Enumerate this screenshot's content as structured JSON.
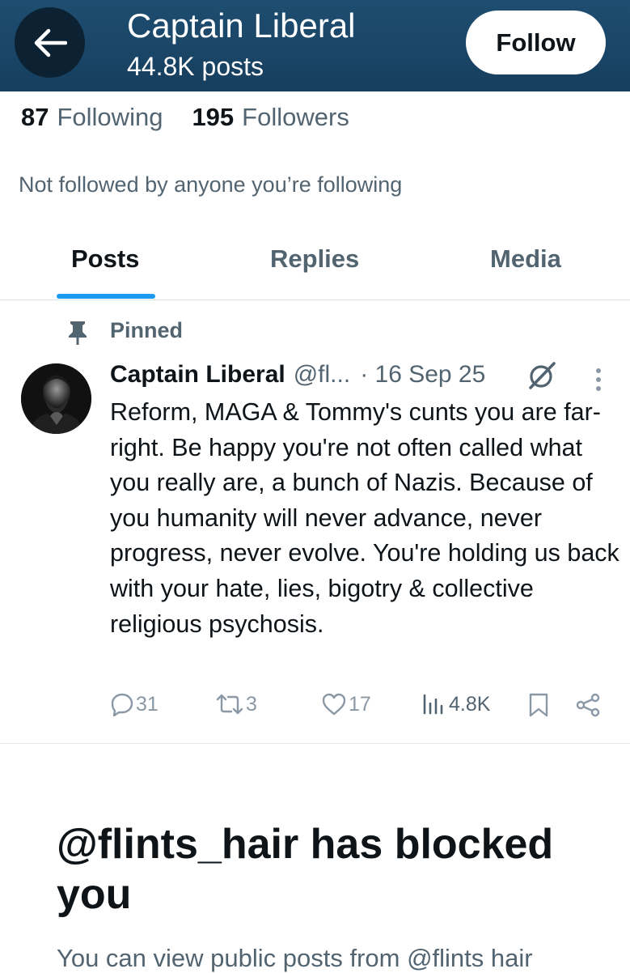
{
  "header": {
    "title": "Captain Liberal",
    "post_count": "44.8K posts",
    "follow_label": "Follow"
  },
  "stats": {
    "following_count": "87",
    "following_label": "Following",
    "followers_count": "195",
    "followers_label": "Followers"
  },
  "not_followed_text": "Not followed by anyone you’re following",
  "tabs": [
    {
      "label": "Posts",
      "active": true
    },
    {
      "label": "Replies",
      "active": false
    },
    {
      "label": "Media",
      "active": false
    }
  ],
  "pinned_tweet": {
    "pinned_label": "Pinned",
    "name": "Captain Liberal",
    "handle": "@fl...",
    "date": "· 16 Sep 25",
    "text": "Reform, MAGA & Tommy's cunts you are far-right. Be happy you're not often called what you really are, a bunch of Nazis. Because of you humanity will never advance, never progress, never evolve. You're holding us back with your hate, lies, bigotry & collective religious psychosis.",
    "replies": "31",
    "reposts": "3",
    "likes": "17",
    "views": "4.8K"
  },
  "blocked": {
    "title": "@flints_hair has blocked you",
    "text": "You can view public posts from @flints hair"
  },
  "colors": {
    "header_bg": "#1a4566",
    "accent": "#1d9bf0",
    "secondary_text": "#536471"
  },
  "icons": {
    "back": "arrow-left-icon",
    "pin": "pin-icon",
    "grok": "grok-icon",
    "more": "more-vertical-icon",
    "reply": "reply-icon",
    "repost": "repost-icon",
    "like": "heart-icon",
    "views": "views-icon",
    "bookmark": "bookmark-icon",
    "share": "share-icon"
  }
}
